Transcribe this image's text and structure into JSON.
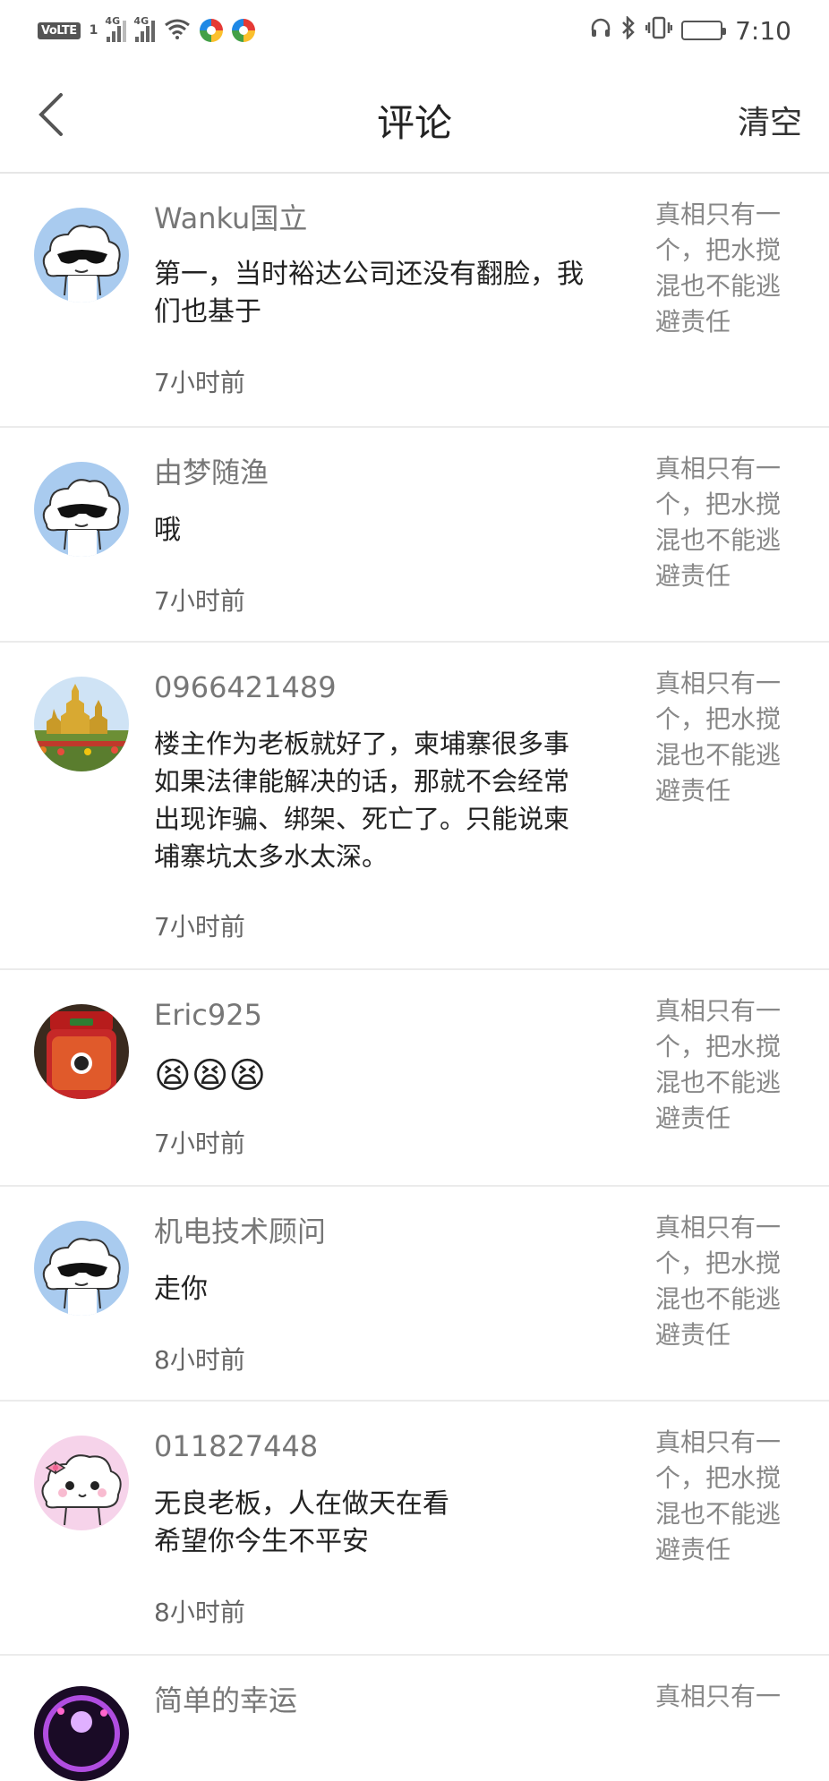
{
  "status_bar": {
    "volte": "VoLTE",
    "sim": "1",
    "net1": "4G",
    "net2": "4G",
    "time": "7:10"
  },
  "header": {
    "title": "评论",
    "clear": "清空"
  },
  "comments": [
    {
      "username": "Wanku国立",
      "text": "第一，当时裕达公司还没有翻脸，我们也基于",
      "time": "7小时前",
      "quoted": "真相只有一个，把水搅混也不能逃避责任",
      "avatar": "cloud-sunglasses"
    },
    {
      "username": "由梦随渔",
      "text": "哦",
      "time": "7小时前",
      "quoted": "真相只有一个，把水搅混也不能逃避责任",
      "avatar": "cloud-sunglasses"
    },
    {
      "username": "0966421489",
      "text": "楼主作为老板就好了，柬埔寨很多事如果法律能解决的话，那就不会经常出现诈骗、绑架、死亡了。只能说柬埔寨坑太多水太深。",
      "time": "7小时前",
      "quoted": "真相只有一个，把水搅混也不能逃避责任",
      "avatar": "temple-photo"
    },
    {
      "username": "Eric925",
      "text": "😫😫😫",
      "time": "7小时前",
      "quoted": "真相只有一个，把水搅混也不能逃避责任",
      "avatar": "jar-photo"
    },
    {
      "username": "机电技术顾问",
      "text": "走你",
      "time": "8小时前",
      "quoted": "真相只有一个，把水搅混也不能逃避责任",
      "avatar": "cloud-sunglasses"
    },
    {
      "username": "011827448",
      "text": "无良老板，人在做天在看\n希望你今生不平安",
      "time": "8小时前",
      "quoted": "真相只有一个，把水搅混也不能逃避责任",
      "avatar": "cloud-bow"
    },
    {
      "username": "简单的幸运",
      "text": "",
      "time": "",
      "quoted": "真相只有一",
      "avatar": "purple-photo"
    }
  ]
}
